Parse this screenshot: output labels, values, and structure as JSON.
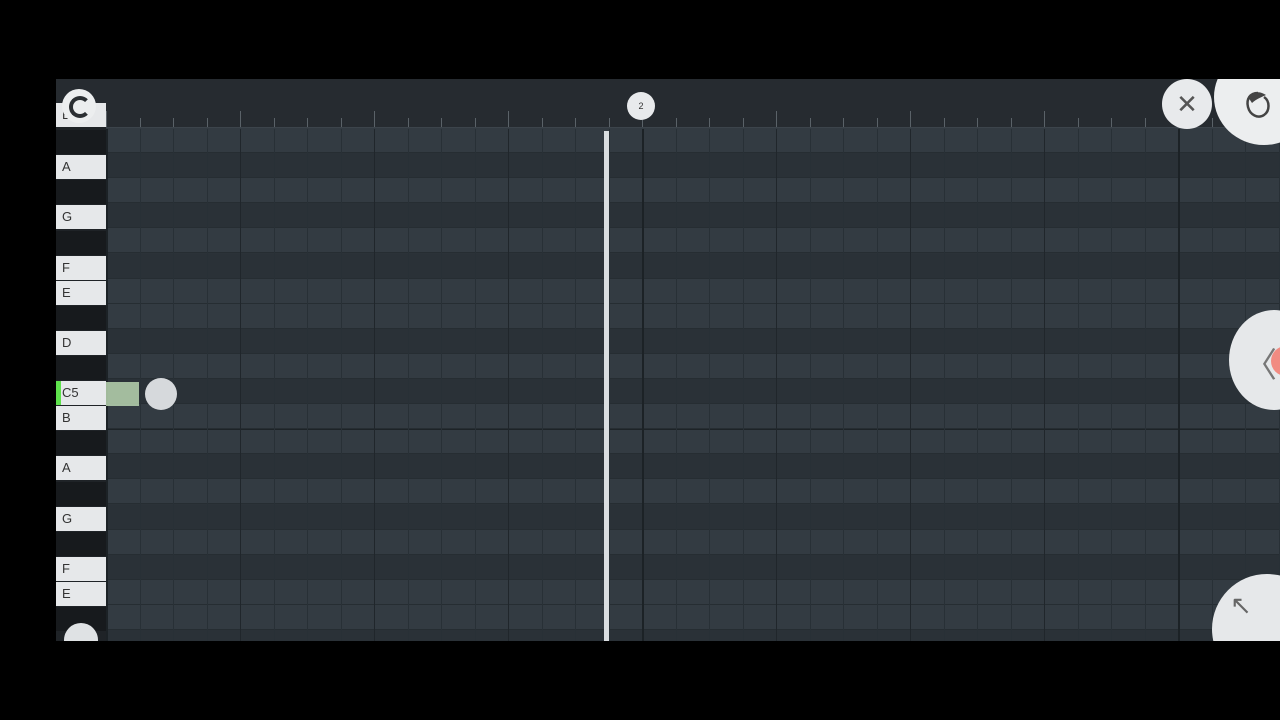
{
  "ruler": {
    "bar_marker": "2"
  },
  "piano_keys": [
    {
      "label": "B",
      "type": "white"
    },
    {
      "label": "",
      "type": "black"
    },
    {
      "label": "A",
      "type": "white"
    },
    {
      "label": "",
      "type": "black"
    },
    {
      "label": "G",
      "type": "white"
    },
    {
      "label": "",
      "type": "black"
    },
    {
      "label": "F",
      "type": "white"
    },
    {
      "label": "E",
      "type": "white"
    },
    {
      "label": "",
      "type": "black"
    },
    {
      "label": "D",
      "type": "white"
    },
    {
      "label": "",
      "type": "black"
    },
    {
      "label": "C5",
      "type": "white",
      "active": true
    },
    {
      "label": "B",
      "type": "white"
    },
    {
      "label": "",
      "type": "black"
    },
    {
      "label": "A",
      "type": "white"
    },
    {
      "label": "",
      "type": "black"
    },
    {
      "label": "G",
      "type": "white"
    },
    {
      "label": "",
      "type": "black"
    },
    {
      "label": "F",
      "type": "white"
    },
    {
      "label": "E",
      "type": "white"
    },
    {
      "label": "",
      "type": "black"
    }
  ],
  "buttons": {
    "close_symbol": "✕",
    "expand_symbol": "↖",
    "side_symbol": "〈"
  },
  "icons": {
    "magnet": "magnet-icon",
    "logo": "fruit-logo-icon",
    "close": "close-icon",
    "collapse": "chevron-left-icon",
    "expand": "arrow-up-left-icon"
  },
  "colors": {
    "active_key_indicator": "#5ee24c",
    "note": "#b9d5b0",
    "record_dot": "#f18b82",
    "playhead": "#d9dde0"
  }
}
